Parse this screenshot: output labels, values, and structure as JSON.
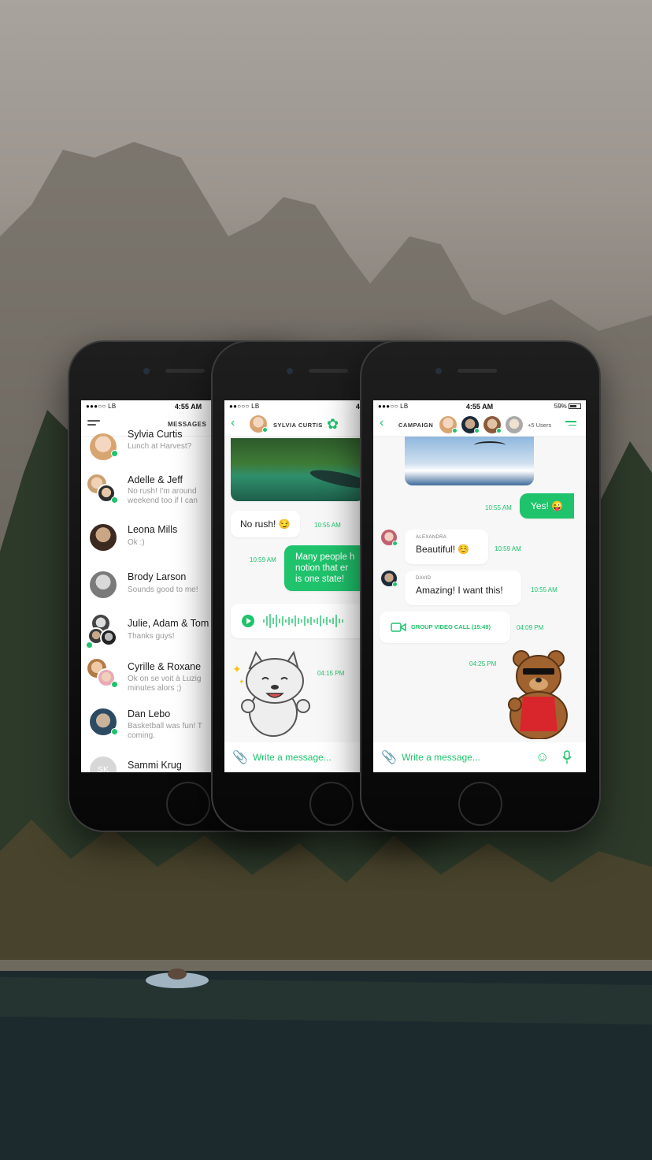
{
  "colors": {
    "accent": "#1fc36c",
    "bubble_out": "#1fc36c",
    "bubble_in": "#ffffff"
  },
  "phone1": {
    "status": {
      "carrier": "●●●○○ LB",
      "time": "4:55 AM"
    },
    "title": "MESSAGES",
    "menu_icon": "hamburger-icon",
    "chats": [
      {
        "name": "Sylvia Curtis",
        "preview": "Lunch at Harvest?",
        "online": true
      },
      {
        "name": "Adelle & Jeff",
        "preview": "No rush! I'm around weekend too if I can",
        "online": true
      },
      {
        "name": "Leona Mills",
        "preview": "Ok :)",
        "online": false
      },
      {
        "name": "Brody Larson",
        "preview": "Sounds good to me!",
        "online": false
      },
      {
        "name": "Julie, Adam & Tom",
        "preview": "Thanks guys!",
        "online": true
      },
      {
        "name": "Cyrille & Roxane",
        "preview": "Ok on se voit à Luzig minutes alors ;)",
        "online": true
      },
      {
        "name": "Dan Lebo",
        "preview": "Basketball was fun! T coming.",
        "online": true
      },
      {
        "name": "Sammi Krug",
        "preview": "",
        "initials": "SK",
        "online": false
      }
    ]
  },
  "phone2": {
    "status": {
      "carrier": "●●○○○ LB",
      "time": "4:55 AM"
    },
    "title": "SYLVIA CURTIS",
    "messages": [
      {
        "text": "No rush! 😏",
        "time": "10:55 AM",
        "out": false
      },
      {
        "text": "Many people h notion that er is one state!",
        "line1": "Many people h",
        "line2": "notion that er",
        "line3": "is one state!",
        "time": "10:59 AM",
        "out": true
      },
      {
        "time": "04:15 PM",
        "sticker": "wolf-sticker"
      }
    ],
    "input_placeholder": "Write a message..."
  },
  "phone3": {
    "status": {
      "carrier": "●●●○○ LB",
      "time": "4:55 AM",
      "battery": "59%"
    },
    "title": "CAMPAIGN",
    "more_users": "+5 Users",
    "messages": [
      {
        "text": "Yes! 😜",
        "time": "10:55 AM",
        "out": true
      },
      {
        "sender": "ALEXANDRA",
        "text": "Beautiful! ☺️",
        "time": "10:59 AM",
        "out": false
      },
      {
        "sender": "DAVID",
        "text": "Amazing! I want this!",
        "time": "10:55 AM",
        "out": false
      },
      {
        "call_label": "GROUP VIDEO CALL (15:49)",
        "time": "04:09 PM"
      },
      {
        "time": "04:25 PM",
        "sticker": "bear-sticker"
      }
    ],
    "input_placeholder": "Write a message..."
  }
}
